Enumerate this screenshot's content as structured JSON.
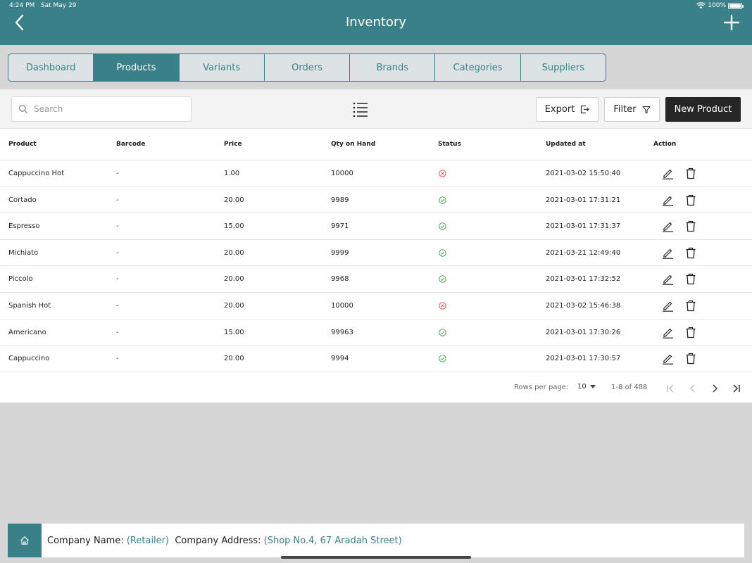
{
  "status_bar": {
    "time": "4:24 PM",
    "date": "Sat May 29",
    "battery": "100%"
  },
  "header": {
    "title": "Inventory"
  },
  "tabs": [
    {
      "label": "Dashboard",
      "active": false
    },
    {
      "label": "Products",
      "active": true
    },
    {
      "label": "Variants",
      "active": false
    },
    {
      "label": "Orders",
      "active": false
    },
    {
      "label": "Brands",
      "active": false
    },
    {
      "label": "Categories",
      "active": false
    },
    {
      "label": "Suppliers",
      "active": false
    }
  ],
  "toolbar": {
    "search_placeholder": "Search",
    "export_label": "Export",
    "filter_label": "Filter",
    "new_product_label": "New Product"
  },
  "table": {
    "columns": [
      "Product",
      "Barcode",
      "Price",
      "Qty on Hand",
      "Status",
      "Updated at",
      "Action"
    ],
    "rows": [
      {
        "product": "Cappuccino Hot",
        "barcode": "-",
        "price": "1.00",
        "qty": "10000",
        "status": "inactive",
        "updated": "2021-03-02 15:50:40"
      },
      {
        "product": "Cortado",
        "barcode": "-",
        "price": "20.00",
        "qty": "9989",
        "status": "active",
        "updated": "2021-03-01 17:31:21"
      },
      {
        "product": "Espresso",
        "barcode": "-",
        "price": "15.00",
        "qty": "9971",
        "status": "active",
        "updated": "2021-03-01 17:31:37"
      },
      {
        "product": "Michiato",
        "barcode": "-",
        "price": "20.00",
        "qty": "9999",
        "status": "active",
        "updated": "2021-03-21 12:49:40"
      },
      {
        "product": "Piccolo",
        "barcode": "-",
        "price": "20.00",
        "qty": "9968",
        "status": "active",
        "updated": "2021-03-01 17:32:52"
      },
      {
        "product": "Spanish Hot",
        "barcode": "-",
        "price": "20.00",
        "qty": "10000",
        "status": "inactive",
        "updated": "2021-03-02 15:46:38"
      },
      {
        "product": "Americano",
        "barcode": "-",
        "price": "15.00",
        "qty": "99963",
        "status": "active",
        "updated": "2021-03-01 17:30:26"
      },
      {
        "product": "Cappuccino",
        "barcode": "-",
        "price": "20.00",
        "qty": "9994",
        "status": "active",
        "updated": "2021-03-01 17:30:57"
      }
    ]
  },
  "pagination": {
    "rows_per_page_label": "Rows per page:",
    "rows_per_page": "10",
    "range": "1-8 of 488"
  },
  "footer": {
    "company_name_label": "Company Name:",
    "company_name": "(Retailer)",
    "company_address_label": "Company Address:",
    "company_address": "(Shop No.4, 67 Aradah Street)"
  },
  "colors": {
    "brand": "#3a8088",
    "active_status": "#2e9a48",
    "inactive_status": "#e23b3b",
    "primary_button": "#262626"
  }
}
